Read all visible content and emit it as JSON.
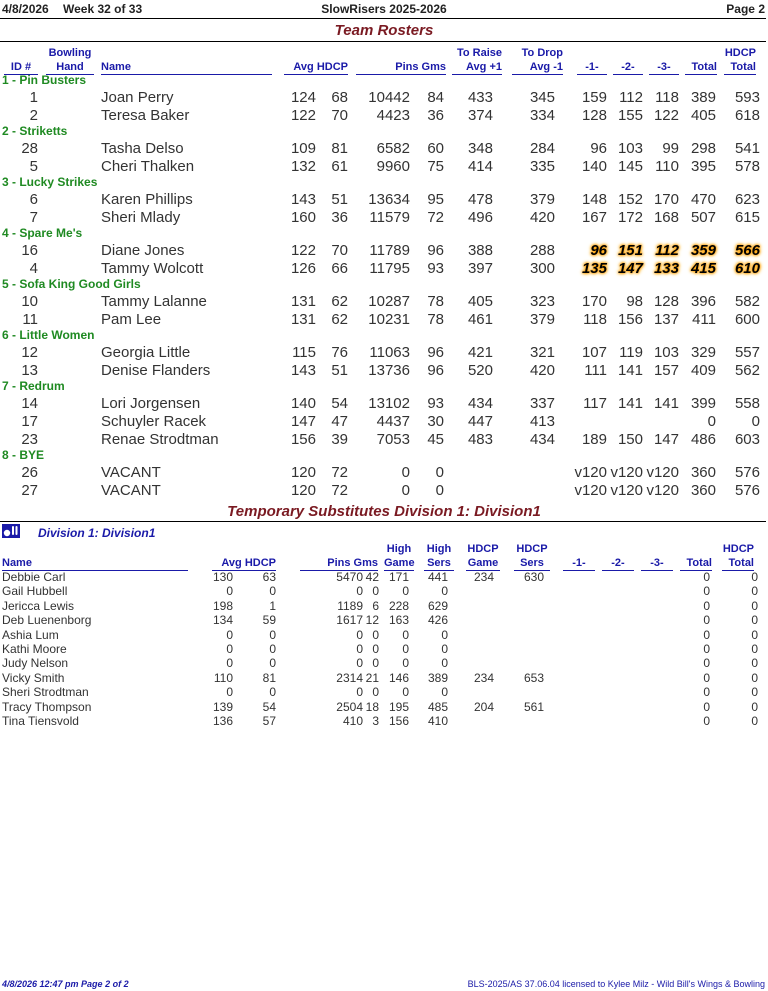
{
  "header": {
    "date": "4/8/2026",
    "week": "Week 32 of 33",
    "league": "SlowRisers 2025-2026",
    "page": "Page 2"
  },
  "rosters_title": "Team Rosters",
  "roster_columns": {
    "id": "ID #",
    "hand1": "Bowling",
    "hand2": "Hand",
    "name": "Name",
    "avg_hdcp": "Avg HDCP",
    "pins_gms": "Pins  Gms",
    "raise1": "To Raise",
    "raise2": "Avg +1",
    "drop1": "To Drop",
    "drop2": "Avg -1",
    "g1": "-1-",
    "g2": "-2-",
    "g3": "-3-",
    "total": "Total",
    "hdcp1": "HDCP",
    "hdcp2": "Total"
  },
  "teams": [
    {
      "name": "1 - Pin Busters",
      "bowlers": [
        {
          "id": "1",
          "name": "Joan Perry",
          "avg": "124",
          "hdcp": "68",
          "pins": "10442",
          "gms": "84",
          "raise": "433",
          "drop": "345",
          "g1": "159",
          "g2": "112",
          "g3": "118",
          "total": "389",
          "hdcp_total": "593"
        },
        {
          "id": "2",
          "name": "Teresa Baker",
          "avg": "122",
          "hdcp": "70",
          "pins": "4423",
          "gms": "36",
          "raise": "374",
          "drop": "334",
          "g1": "128",
          "g2": "155",
          "g3": "122",
          "total": "405",
          "hdcp_total": "618"
        }
      ]
    },
    {
      "name": "2 - Striketts",
      "bowlers": [
        {
          "id": "28",
          "name": "Tasha Delso",
          "avg": "109",
          "hdcp": "81",
          "pins": "6582",
          "gms": "60",
          "raise": "348",
          "drop": "284",
          "g1": "96",
          "g2": "103",
          "g3": "99",
          "total": "298",
          "hdcp_total": "541"
        },
        {
          "id": "5",
          "name": "Cheri Thalken",
          "avg": "132",
          "hdcp": "61",
          "pins": "9960",
          "gms": "75",
          "raise": "414",
          "drop": "335",
          "g1": "140",
          "g2": "145",
          "g3": "110",
          "total": "395",
          "hdcp_total": "578"
        }
      ]
    },
    {
      "name": "3 - Lucky Strikes",
      "bowlers": [
        {
          "id": "6",
          "name": "Karen Phillips",
          "avg": "143",
          "hdcp": "51",
          "pins": "13634",
          "gms": "95",
          "raise": "478",
          "drop": "379",
          "g1": "148",
          "g2": "152",
          "g3": "170",
          "total": "470",
          "hdcp_total": "623"
        },
        {
          "id": "7",
          "name": "Sheri Mlady",
          "avg": "160",
          "hdcp": "36",
          "pins": "11579",
          "gms": "72",
          "raise": "496",
          "drop": "420",
          "g1": "167",
          "g2": "172",
          "g3": "168",
          "total": "507",
          "hdcp_total": "615"
        }
      ]
    },
    {
      "name": "4 - Spare Me's",
      "highlight": true,
      "bowlers": [
        {
          "id": "16",
          "name": "Diane Jones",
          "avg": "122",
          "hdcp": "70",
          "pins": "11789",
          "gms": "96",
          "raise": "388",
          "drop": "288",
          "g1": "96",
          "g2": "151",
          "g3": "112",
          "total": "359",
          "hdcp_total": "566"
        },
        {
          "id": "4",
          "name": "Tammy Wolcott",
          "avg": "126",
          "hdcp": "66",
          "pins": "11795",
          "gms": "93",
          "raise": "397",
          "drop": "300",
          "g1": "135",
          "g2": "147",
          "g3": "133",
          "total": "415",
          "hdcp_total": "610"
        }
      ]
    },
    {
      "name": "5 - Sofa King Good Girls",
      "bowlers": [
        {
          "id": "10",
          "name": "Tammy Lalanne",
          "avg": "131",
          "hdcp": "62",
          "pins": "10287",
          "gms": "78",
          "raise": "405",
          "drop": "323",
          "g1": "170",
          "g2": "98",
          "g3": "128",
          "total": "396",
          "hdcp_total": "582"
        },
        {
          "id": "11",
          "name": "Pam Lee",
          "avg": "131",
          "hdcp": "62",
          "pins": "10231",
          "gms": "78",
          "raise": "461",
          "drop": "379",
          "g1": "118",
          "g2": "156",
          "g3": "137",
          "total": "411",
          "hdcp_total": "600"
        }
      ]
    },
    {
      "name": "6 - Little Women",
      "bowlers": [
        {
          "id": "12",
          "name": "Georgia Little",
          "avg": "115",
          "hdcp": "76",
          "pins": "11063",
          "gms": "96",
          "raise": "421",
          "drop": "321",
          "g1": "107",
          "g2": "119",
          "g3": "103",
          "total": "329",
          "hdcp_total": "557"
        },
        {
          "id": "13",
          "name": "Denise Flanders",
          "avg": "143",
          "hdcp": "51",
          "pins": "13736",
          "gms": "96",
          "raise": "520",
          "drop": "420",
          "g1": "111",
          "g2": "141",
          "g3": "157",
          "total": "409",
          "hdcp_total": "562"
        }
      ]
    },
    {
      "name": "7 - Redrum",
      "bowlers": [
        {
          "id": "14",
          "name": "Lori Jorgensen",
          "avg": "140",
          "hdcp": "54",
          "pins": "13102",
          "gms": "93",
          "raise": "434",
          "drop": "337",
          "g1": "117",
          "g2": "141",
          "g3": "141",
          "total": "399",
          "hdcp_total": "558"
        },
        {
          "id": "17",
          "name": "Schuyler Racek",
          "avg": "147",
          "hdcp": "47",
          "pins": "4437",
          "gms": "30",
          "raise": "447",
          "drop": "413",
          "g1": "",
          "g2": "",
          "g3": "",
          "total": "0",
          "hdcp_total": "0"
        },
        {
          "id": "23",
          "name": "Renae Strodtman",
          "avg": "156",
          "hdcp": "39",
          "pins": "7053",
          "gms": "45",
          "raise": "483",
          "drop": "434",
          "g1": "189",
          "g2": "150",
          "g3": "147",
          "total": "486",
          "hdcp_total": "603"
        }
      ]
    },
    {
      "name": "8 - BYE",
      "bowlers": [
        {
          "id": "26",
          "name": "VACANT",
          "avg": "120",
          "hdcp": "72",
          "pins": "0",
          "gms": "0",
          "raise": "",
          "drop": "",
          "g1": "v120",
          "g2": "v120",
          "g3": "v120",
          "total": "360",
          "hdcp_total": "576"
        },
        {
          "id": "27",
          "name": "VACANT",
          "avg": "120",
          "hdcp": "72",
          "pins": "0",
          "gms": "0",
          "raise": "",
          "drop": "",
          "g1": "v120",
          "g2": "v120",
          "g3": "v120",
          "total": "360",
          "hdcp_total": "576"
        }
      ]
    }
  ],
  "subs_title": "Temporary Substitutes   Division 1: Division1",
  "division_label": "Division 1: Division1",
  "division_icon": "bowling-icon",
  "sub_columns": {
    "name": "Name",
    "avg_hdcp": "Avg HDCP",
    "pins_gms": "Pins  Gms",
    "hg1": "High",
    "hg2": "Game",
    "hs1": "High",
    "hs2": "Sers",
    "hhg1": "HDCP",
    "hhg2": "Game",
    "hhs1": "HDCP",
    "hhs2": "Sers",
    "g1": "-1-",
    "g2": "-2-",
    "g3": "-3-",
    "total": "Total",
    "ht1": "HDCP",
    "ht2": "Total"
  },
  "subs": [
    {
      "name": "Debbie Carl",
      "avg": "130",
      "hdcp": "63",
      "pins": "5470",
      "gms": "42",
      "hg": "171",
      "hs": "441",
      "hhg": "234",
      "hhs": "630",
      "total": "0",
      "hdcp_total": "0"
    },
    {
      "name": "Gail Hubbell",
      "avg": "0",
      "hdcp": "0",
      "pins": "0",
      "gms": "0",
      "hg": "0",
      "hs": "0",
      "hhg": "",
      "hhs": "",
      "total": "0",
      "hdcp_total": "0"
    },
    {
      "name": "Jericca Lewis",
      "avg": "198",
      "hdcp": "1",
      "pins": "1189",
      "gms": "6",
      "hg": "228",
      "hs": "629",
      "hhg": "",
      "hhs": "",
      "total": "0",
      "hdcp_total": "0"
    },
    {
      "name": "Deb Luenenborg",
      "avg": "134",
      "hdcp": "59",
      "pins": "1617",
      "gms": "12",
      "hg": "163",
      "hs": "426",
      "hhg": "",
      "hhs": "",
      "total": "0",
      "hdcp_total": "0"
    },
    {
      "name": "Ashia Lum",
      "avg": "0",
      "hdcp": "0",
      "pins": "0",
      "gms": "0",
      "hg": "0",
      "hs": "0",
      "hhg": "",
      "hhs": "",
      "total": "0",
      "hdcp_total": "0"
    },
    {
      "name": "Kathi Moore",
      "avg": "0",
      "hdcp": "0",
      "pins": "0",
      "gms": "0",
      "hg": "0",
      "hs": "0",
      "hhg": "",
      "hhs": "",
      "total": "0",
      "hdcp_total": "0"
    },
    {
      "name": "Judy Nelson",
      "avg": "0",
      "hdcp": "0",
      "pins": "0",
      "gms": "0",
      "hg": "0",
      "hs": "0",
      "hhg": "",
      "hhs": "",
      "total": "0",
      "hdcp_total": "0"
    },
    {
      "name": "Vicky Smith",
      "avg": "110",
      "hdcp": "81",
      "pins": "2314",
      "gms": "21",
      "hg": "146",
      "hs": "389",
      "hhg": "234",
      "hhs": "653",
      "total": "0",
      "hdcp_total": "0"
    },
    {
      "name": "Sheri Strodtman",
      "avg": "0",
      "hdcp": "0",
      "pins": "0",
      "gms": "0",
      "hg": "0",
      "hs": "0",
      "hhg": "",
      "hhs": "",
      "total": "0",
      "hdcp_total": "0"
    },
    {
      "name": "Tracy Thompson",
      "avg": "139",
      "hdcp": "54",
      "pins": "2504",
      "gms": "18",
      "hg": "195",
      "hs": "485",
      "hhg": "204",
      "hhs": "561",
      "total": "0",
      "hdcp_total": "0"
    },
    {
      "name": "Tina Tiensvold",
      "avg": "136",
      "hdcp": "57",
      "pins": "410",
      "gms": "3",
      "hg": "156",
      "hs": "410",
      "hhg": "",
      "hhs": "",
      "total": "0",
      "hdcp_total": "0"
    }
  ],
  "footer": {
    "left": "4/8/2026  12:47 pm  Page 2 of 2",
    "right": "BLS-2025/AS 37.06.04 licensed to Kylee Milz - Wild Bill's Wings & Bowling"
  }
}
